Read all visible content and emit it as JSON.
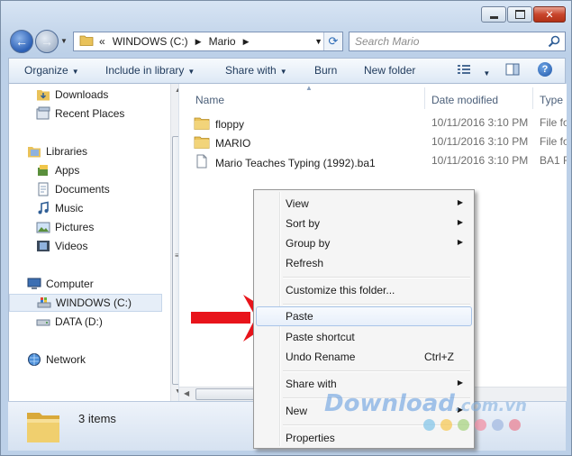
{
  "address_bar": {
    "overflow": "«",
    "crumbs": [
      "WINDOWS (C:)",
      "Mario"
    ]
  },
  "search": {
    "placeholder": "Search Mario"
  },
  "toolbar": {
    "organize": "Organize",
    "include_in_library": "Include in library",
    "share_with": "Share with",
    "burn": "Burn",
    "new_folder": "New folder"
  },
  "nav_pane": {
    "favorites": [
      "Downloads",
      "Recent Places"
    ],
    "libraries": {
      "label": "Libraries",
      "items": [
        "Apps",
        "Documents",
        "Music",
        "Pictures",
        "Videos"
      ]
    },
    "computer": {
      "label": "Computer",
      "drives": [
        "WINDOWS (C:)",
        "DATA (D:)"
      ]
    },
    "network": "Network"
  },
  "columns": {
    "name": "Name",
    "date_modified": "Date modified",
    "type": "Type"
  },
  "files": [
    {
      "name": "floppy",
      "date": "10/11/2016 3:10 PM",
      "type": "File fo",
      "icon": "folder-icon"
    },
    {
      "name": "MARIO",
      "date": "10/11/2016 3:10 PM",
      "type": "File fo",
      "icon": "folder-icon"
    },
    {
      "name": "Mario Teaches Typing (1992).ba1",
      "date": "10/11/2016 3:10 PM",
      "type": "BA1 F",
      "icon": "file-icon"
    }
  ],
  "status": {
    "items_count": "3 items"
  },
  "context_menu": {
    "view": "View",
    "sort_by": "Sort by",
    "group_by": "Group by",
    "refresh": "Refresh",
    "customize": "Customize this folder...",
    "paste": "Paste",
    "paste_shortcut": "Paste shortcut",
    "undo_rename": "Undo Rename",
    "undo_shortcut": "Ctrl+Z",
    "share_with": "Share with",
    "new": "New",
    "properties": "Properties"
  },
  "watermark": {
    "text": "Download",
    "domain": ".com.vn"
  },
  "colors": {
    "accent": "#3a78c9",
    "arrow_red": "#e8141b",
    "dot_colors": [
      "#7fc3e8",
      "#f6c64d",
      "#a4d17a",
      "#f28aa0",
      "#9fb6e0",
      "#e97c8f"
    ]
  }
}
